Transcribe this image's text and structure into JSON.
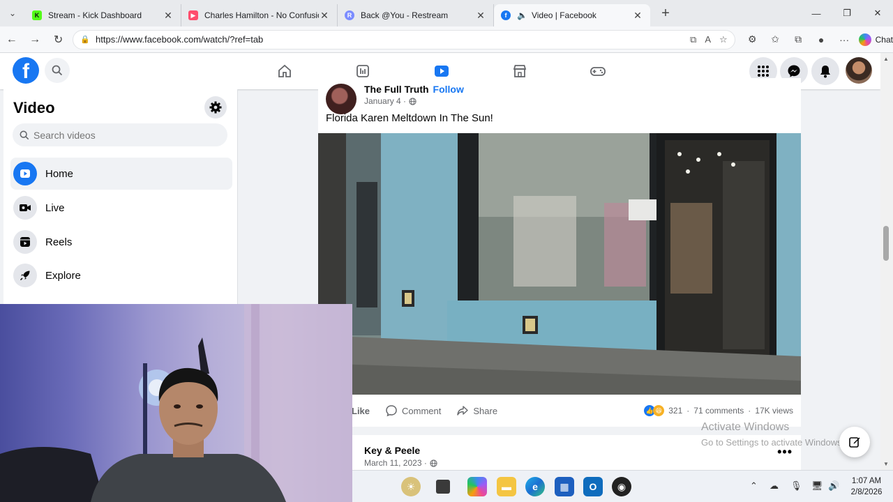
{
  "browser": {
    "tabs": [
      {
        "title": "Stream - Kick Dashboard",
        "favicon_color": "#53fc18",
        "active": false
      },
      {
        "title": "Charles Hamilton - No Confusion",
        "favicon_color": "#ff4d6d",
        "active": false
      },
      {
        "title": "Back @You - Restream",
        "favicon_color": "#7b8cff",
        "active": false
      },
      {
        "title": "Video | Facebook",
        "favicon_color": "#1877f2",
        "active": true
      }
    ],
    "url": "https://www.facebook.com/watch/?ref=tab",
    "chat_label": "Chat"
  },
  "facebook": {
    "logo_letter": "f",
    "sidebar": {
      "title": "Video",
      "search_placeholder": "Search videos",
      "items": [
        {
          "label": "Home",
          "icon": "play-icon",
          "active": true
        },
        {
          "label": "Live",
          "icon": "live-camera-icon",
          "active": false
        },
        {
          "label": "Reels",
          "icon": "reels-icon",
          "active": false
        },
        {
          "label": "Explore",
          "icon": "rocket-icon",
          "active": false
        }
      ]
    },
    "posts": [
      {
        "author": "The Full Truth",
        "follow_label": "Follow",
        "date": "January 4 ·",
        "title": "Florida Karen Meltdown In The Sun!",
        "actions": {
          "like": "Like",
          "comment": "Comment",
          "share": "Share"
        },
        "reactions_count": "321",
        "comments": "71 comments",
        "views": "17K views"
      },
      {
        "author": "Key & Peele",
        "date": "March 11, 2023 ·"
      }
    ]
  },
  "watermark": {
    "line1": "Activate Windows",
    "line2": "Go to Settings to activate Windows."
  },
  "taskbar": {
    "time": "1:07 AM",
    "date": "2/8/2026"
  },
  "colors": {
    "facebook_blue": "#1877f2",
    "page_bg": "#f0f2f5"
  }
}
